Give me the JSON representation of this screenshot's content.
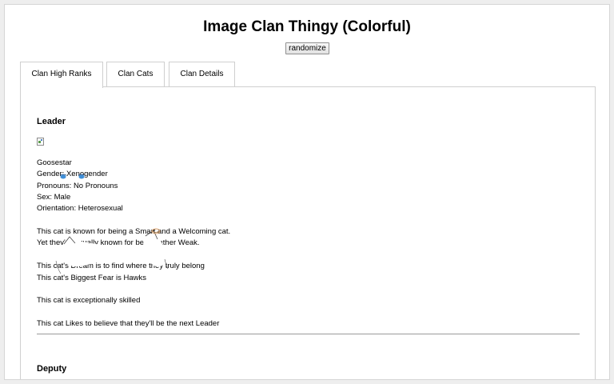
{
  "page": {
    "title": "Image Clan Thingy (Colorful)",
    "randomize_label": "randomize"
  },
  "tabs": [
    {
      "label": "Clan High Ranks",
      "active": true
    },
    {
      "label": "Clan Cats",
      "active": false
    },
    {
      "label": "Clan Details",
      "active": false
    }
  ],
  "leader": {
    "heading": "Leader",
    "name": "Goosestar",
    "gender": "Gender: Xenogender",
    "pronouns": "Pronouns: No Pronouns",
    "sex": "Sex: Male",
    "orientation": "Orientation: Heterosexual",
    "known_for": "This cat is known for being a Smart and a Welcoming cat.",
    "also_known": "Yet they're equally known for being rather Weak.",
    "dream": "This cat's Dream is to find where they truly belong",
    "fear": "This cat's Biggest Fear is Hawks",
    "skill": "This cat is exceptionally skilled",
    "likes": "This cat Likes to believe that they'll be the next Leader"
  },
  "deputy": {
    "heading": "Deputy"
  },
  "colors": {
    "page_bg": "#eeeeee",
    "eye_blue": "#3f8fd8",
    "nose": "#d9a06a"
  },
  "icons": [
    "broken-image-icon",
    "cat-face-overlay"
  ]
}
